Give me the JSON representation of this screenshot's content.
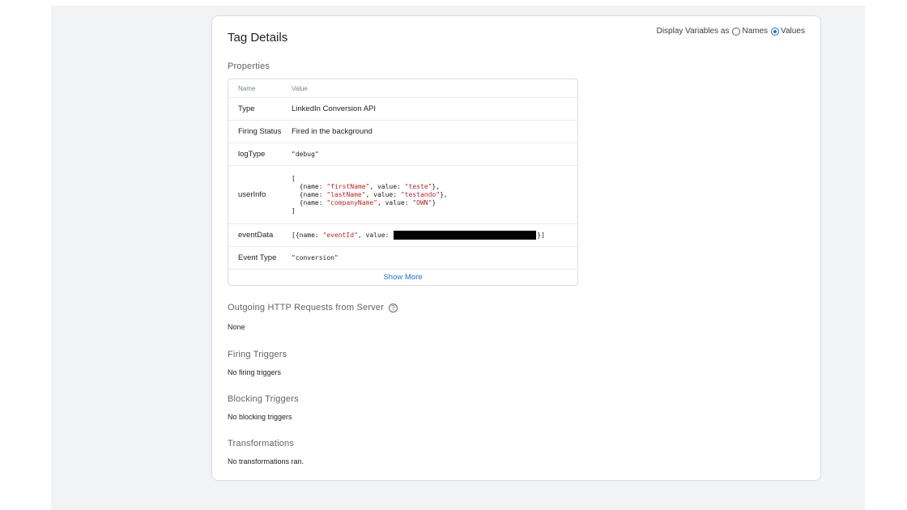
{
  "card": {
    "title": "Tag Details",
    "display_vars": {
      "label": "Display Variables as",
      "options": [
        "Names",
        "Values"
      ],
      "selected": "Values"
    }
  },
  "properties": {
    "section_label": "Properties",
    "header": {
      "name": "Name",
      "value": "Value"
    },
    "rows": [
      {
        "name": "Type",
        "value": "LinkedIn Conversion API"
      },
      {
        "name": "Firing Status",
        "value": "Fired in the background"
      },
      {
        "name": "logType",
        "value": "\"debug\""
      },
      {
        "name": "userInfo",
        "value_lines": [
          "[",
          "  {name: \"firstName\", value: \"teste\"},",
          "  {name: \"lastName\", value: \"testando\"},",
          "  {name: \"companyName\", value: \"OWN\"}",
          "]"
        ]
      },
      {
        "name": "eventData",
        "value_prefix": "[{name: \"eventId\", value: ",
        "value_suffix": "}]"
      },
      {
        "name": "Event Type",
        "value": "\"conversion\""
      }
    ],
    "show_more": "Show More"
  },
  "outgoing": {
    "label": "Outgoing HTTP Requests from Server",
    "value": "None"
  },
  "firing_triggers": {
    "label": "Firing Triggers",
    "value": "No firing triggers"
  },
  "blocking_triggers": {
    "label": "Blocking Triggers",
    "value": "No blocking triggers"
  },
  "transformations": {
    "label": "Transformations",
    "value": "No transformations ran."
  },
  "colors": {
    "link": "#1a73e8",
    "string": "#c5221f",
    "border": "#dadce0",
    "background": "#f1f3f4"
  }
}
